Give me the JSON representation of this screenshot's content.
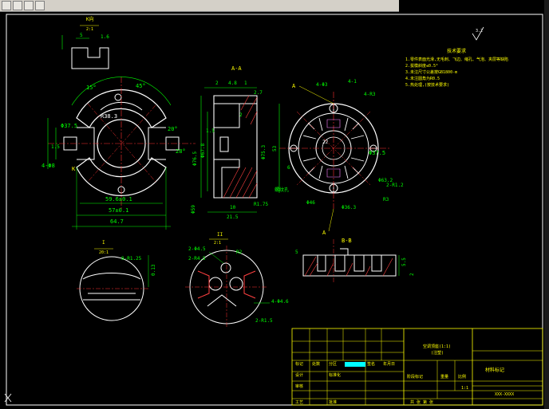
{
  "colors": {
    "background": "#000000",
    "outline": "#ffffff",
    "dimension": "#00ff00",
    "centerline": "#ff3030",
    "annotation": "#ffff00",
    "hatch": "#ff4040",
    "hidden": "#ff80ff"
  },
  "views": {
    "k_view": {
      "title": "K向",
      "scale": "2:1",
      "dims": [
        "5",
        "1.6"
      ]
    },
    "main_view": {
      "dims": [
        "45°",
        "15°",
        "R38.3",
        "Φ37.5",
        "20°",
        "28°",
        "1.5",
        "4-Φ8",
        "59.6±0.1",
        "57±0.1",
        "64.7",
        "K"
      ]
    },
    "section_aa": {
      "title": "A-A",
      "dims": [
        "2",
        "4.8",
        "1",
        "2.7",
        "1.5",
        "2",
        "Φ76.5",
        "Φ67.8",
        "Φ75.3",
        "Φ59",
        "R1.75",
        "10",
        "21.5"
      ]
    },
    "right_view": {
      "label_a_top": "A",
      "label_a_bottom": "A",
      "dims": [
        "4-Φ3",
        "4-R3",
        "Φ37.5",
        "Φ63.2",
        "Φ46",
        "Φ36.3",
        "2-R1.2",
        "R3",
        "6",
        "4-1",
        "53",
        "22"
      ],
      "note": "螺纹孔"
    },
    "detail_i": {
      "label": "I",
      "scale": "20:1",
      "dims": [
        "8-R1.25",
        "0.13"
      ]
    },
    "detail_ii": {
      "label": "II",
      "scale": "2:1",
      "dims": [
        "2-Φ4.5",
        "2-R4.5",
        "2-R1.5",
        "4-Φ4.6",
        "R2"
      ]
    },
    "section_bb": {
      "title": "B-B",
      "dims": [
        "5",
        "5.5",
        "2"
      ]
    }
  },
  "tech_requirements": {
    "heading": "技术要求",
    "items": [
      "1.零件表面光滑,无毛刺、飞边、缩孔、气泡、夹层等缺陷",
      "2.拔模斜度≤0.5°",
      "3.未注尺寸公差按GB1800-m",
      "4.未注圆角为R0.5",
      "5.热处理,(按技术要求)"
    ]
  },
  "title_block": {
    "part_name": "空调顶座(1:1)",
    "part_sub": "(注塑)",
    "material": "材料标记",
    "company": "某某单位",
    "cells": [
      "标记",
      "处数",
      "分区",
      "更改文件号",
      "签名",
      "年月日",
      "设计",
      "标准化",
      "审核",
      "工艺",
      "批准",
      "阶段标记",
      "重量",
      "比例",
      "共 张",
      "第 张"
    ],
    "scale": "1:1",
    "sheet": "共 张 第 张",
    "drawing_no": "XXX-XXXX"
  },
  "roughness_symbol": {
    "value": "3.2"
  }
}
